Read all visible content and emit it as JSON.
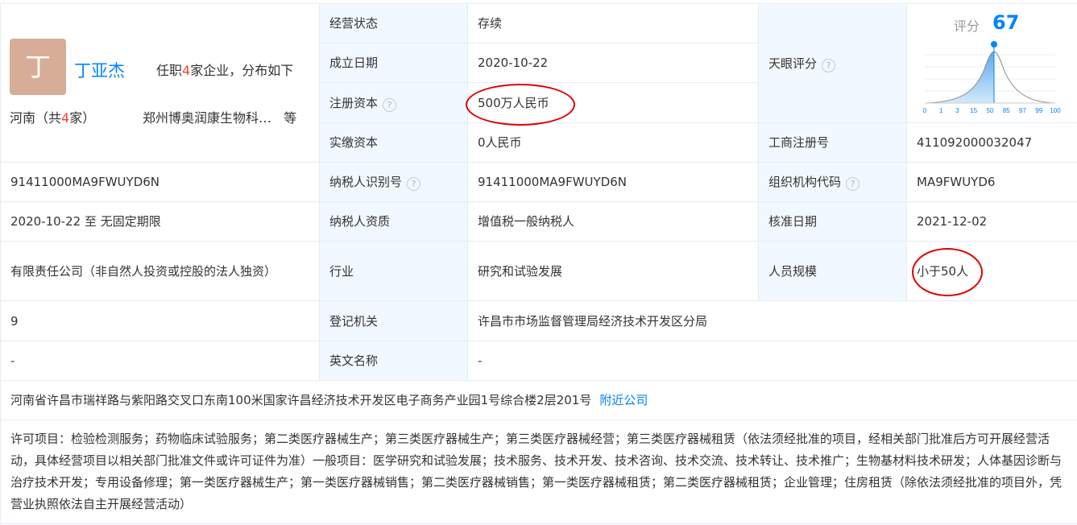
{
  "person": {
    "avatar_char": "丁",
    "name": "丁亚杰",
    "jobs_prefix": "任职",
    "jobs_count": "4",
    "jobs_suffix": "家企业，分布如下",
    "region_prefix": "河南（共",
    "region_count": "4",
    "region_suffix": "家）",
    "companies": "郑州博奥润康生物科…",
    "companies_suffix": "等"
  },
  "score": {
    "label": "评分",
    "value": "67",
    "axis": [
      "0",
      "1",
      "3",
      "15",
      "50",
      "85",
      "97",
      "99",
      "100"
    ],
    "percentile": 50
  },
  "rows": {
    "status_label": "经营状态",
    "status_value": "存续",
    "founded_label": "成立日期",
    "founded_value": "2020-10-22",
    "tianyan_label": "天眼评分",
    "reg_capital_label": "注册资本",
    "reg_capital_value": "500万人民币",
    "paid_capital_label": "实缴资本",
    "paid_capital_value": "0人民币",
    "biz_reg_label": "工商注册号",
    "biz_reg_value": "411092000032047",
    "credit_code": "91411000MA9FWUYD6N",
    "taxpayer_id_label": "纳税人识别号",
    "taxpayer_id_value": "91411000MA9FWUYD6N",
    "org_code_label": "组织机构代码",
    "org_code_value": "MA9FWUYD6",
    "term": "2020-10-22 至 无固定期限",
    "taxpayer_type_label": "纳税人资质",
    "taxpayer_type_value": "增值税一般纳税人",
    "approve_label": "核准日期",
    "approve_value": "2021-12-02",
    "company_type": "有限责任公司（非自然人投资或控股的法人独资）",
    "industry_label": "行业",
    "industry_value": "研究和试验发展",
    "staff_label": "人员规模",
    "staff_value": "小于50人",
    "insured": "9",
    "authority_label": "登记机关",
    "authority_value": "许昌市市场监督管理局经济技术开发区分局",
    "former_name": "-",
    "english_label": "英文名称",
    "english_value": "-",
    "address": "河南省许昌市瑞祥路与紫阳路交叉口东南100米国家许昌经济技术开发区电子商务产业园1号综合楼2层201号",
    "nearby_link": "附近公司",
    "scope": "许可项目：检验检测服务；药物临床试验服务；第二类医疗器械生产；第三类医疗器械生产；第三类医疗器械经营；第三类医疗器械租赁（依法须经批准的项目，经相关部门批准后方可开展经营活动，具体经营项目以相关部门批准文件或许可证件为准）一般项目：医学研究和试验发展；技术服务、技术开发、技术咨询、技术交流、技术转让、技术推广；生物基材料技术研发；人体基因诊断与治疗技术开发；专用设备修理；第一类医疗器械生产；第一类医疗器械销售；第二类医疗器械销售；第一类医疗器械租赁；第二类医疗器械租赁；企业管理；住房租赁（除依法须经批准的项目外，凭营业执照依法自主开展经营活动）"
  },
  "colors": {
    "accent": "#0084ff",
    "label_bg": "#f2f8ff",
    "highlight": "#ff3b30",
    "annotation": "#e00000"
  }
}
